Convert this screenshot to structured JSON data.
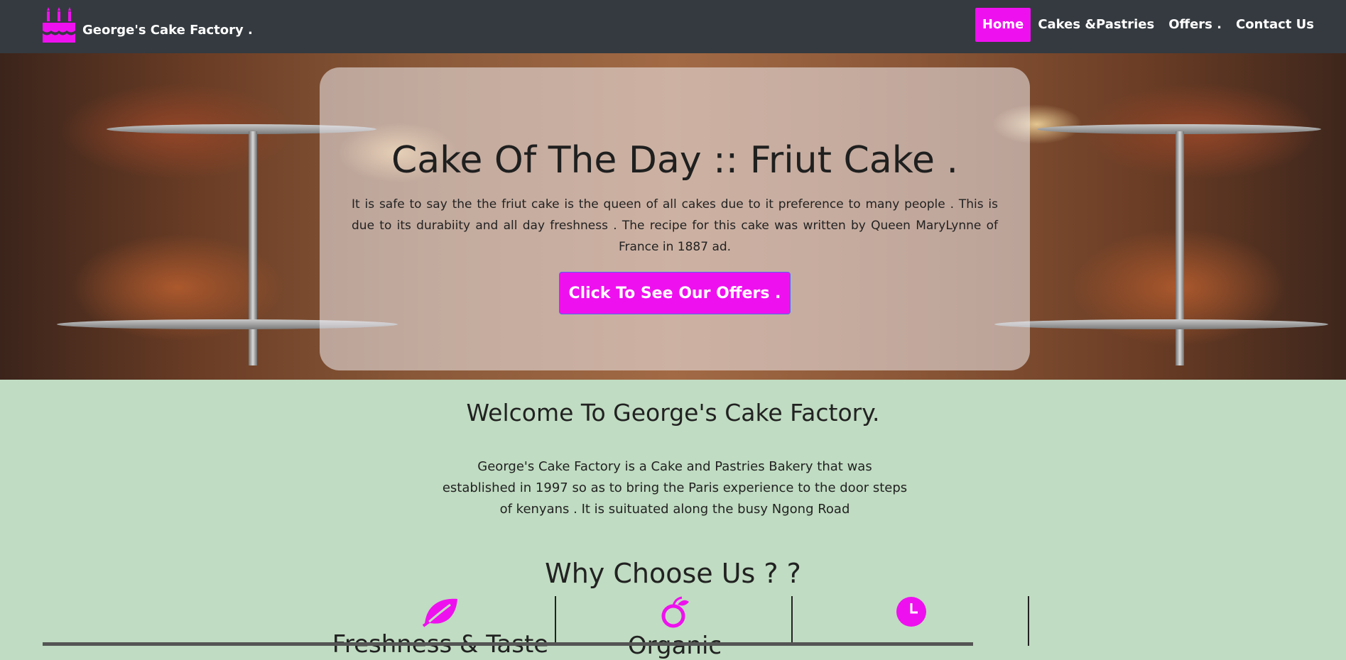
{
  "brand": {
    "name": "George's Cake Factory .",
    "icon": "birthday-cake-icon"
  },
  "nav": {
    "items": [
      {
        "label": "Home",
        "active": true
      },
      {
        "label": "Cakes &Pastries",
        "active": false
      },
      {
        "label": "Offers .",
        "active": false
      },
      {
        "label": "Contact Us",
        "active": false
      }
    ]
  },
  "hero": {
    "title": "Cake Of The Day :: Friut Cake .",
    "text": "It  is safe to  say the  the friut cake is  the  queen of all cakes  due to it  preference  to  many people   .  This is  due  to  its  durabiity  and all day freshness . The  recipe  for  this  cake  was  written  by  Queen MaryLynne  of France in 1887 ad.",
    "button_label": "Click To See Our Offers ."
  },
  "welcome": {
    "title": "Welcome To George's Cake Factory.",
    "text": "George's Cake Factory is a Cake and Pastries Bakery that was established in 1997  so as to bring the Paris experience to the door steps of kenyans . It is suituated along the busy Ngong Road"
  },
  "why": {
    "title": "Why Choose Us ? ?",
    "features": [
      {
        "icon": "leaf-icon",
        "label": "Freshness & Taste"
      },
      {
        "icon": "organic-fruit-icon",
        "label": "Organic"
      },
      {
        "icon": "clock-icon",
        "label": ""
      }
    ]
  },
  "colors": {
    "accent": "#ef10ef",
    "navbar": "#343a40",
    "section_bg": "#c0dcc2"
  }
}
